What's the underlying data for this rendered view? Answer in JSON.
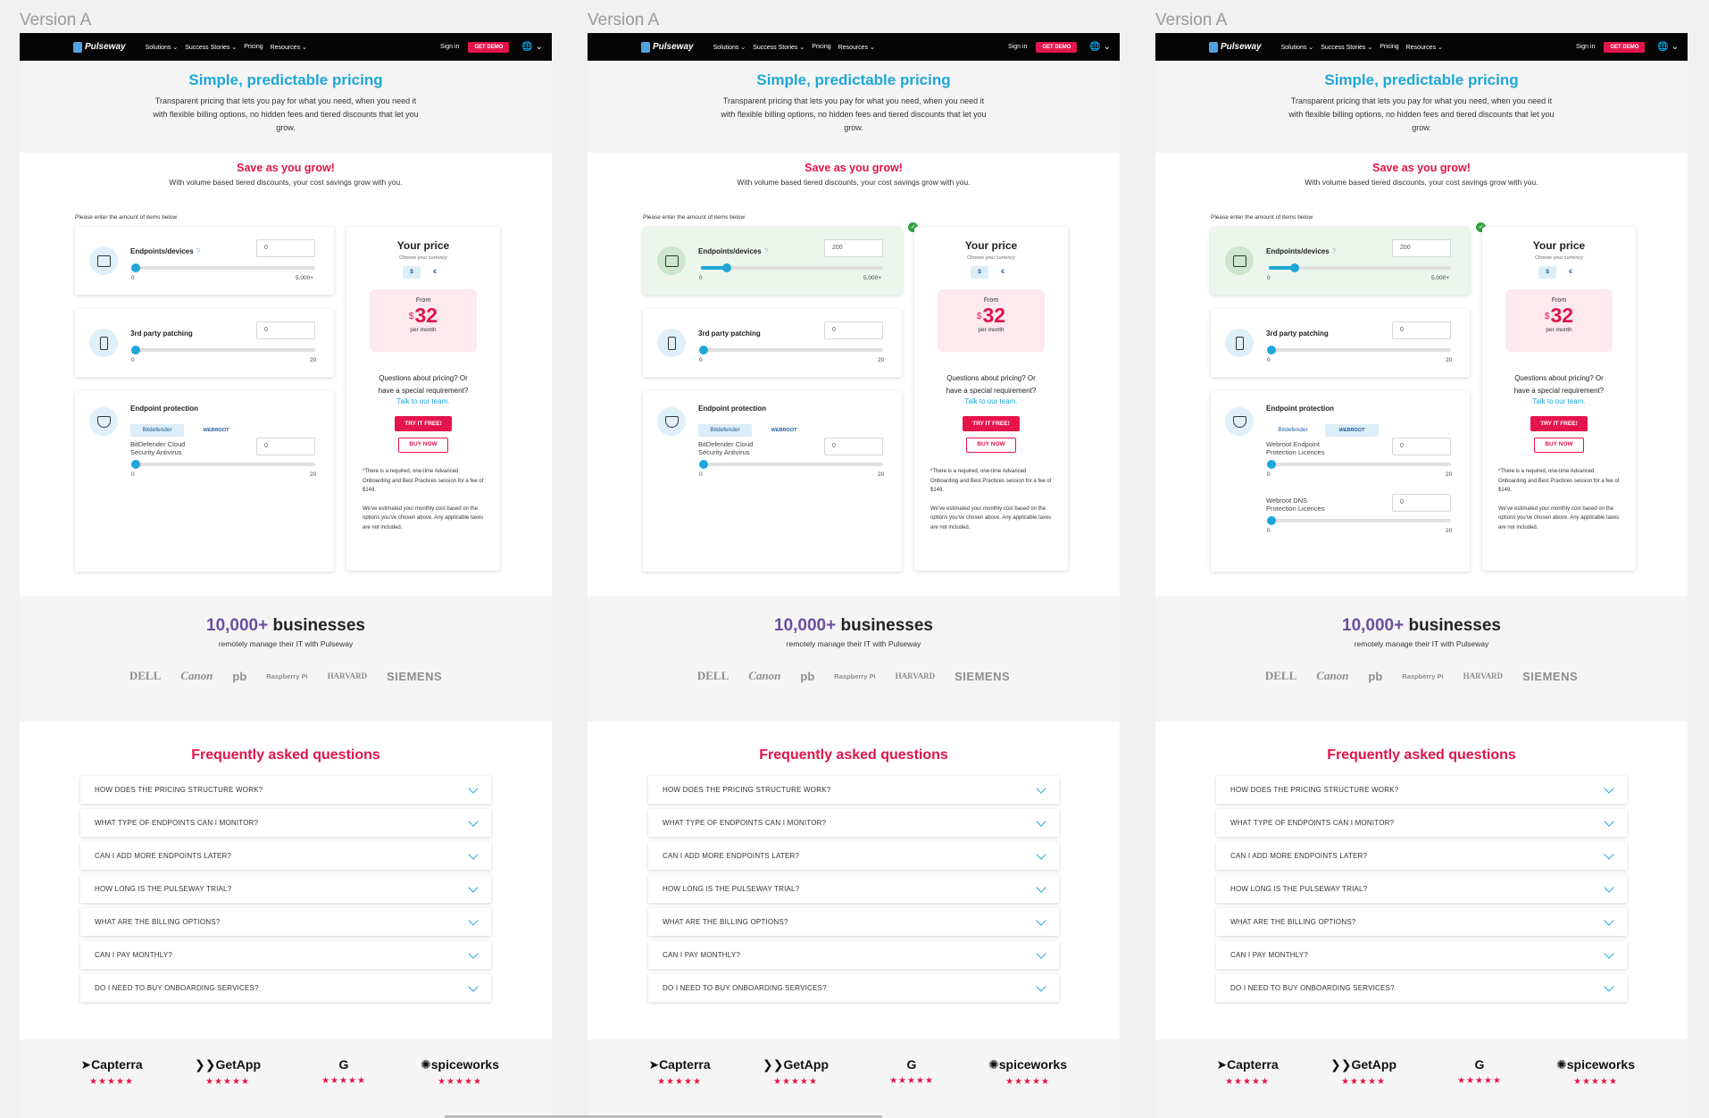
{
  "versions": [
    {
      "label": "Version A",
      "endpoints": {
        "value": "0",
        "state": "default"
      },
      "protection_selected": "bitdefender",
      "protection_rows": [
        {
          "label_line1": "BitDefender Cloud",
          "label_line2": "Security Antivirus",
          "value": "0",
          "max": "20"
        }
      ]
    },
    {
      "label": "Version A",
      "endpoints": {
        "value": "200",
        "state": "active"
      },
      "protection_selected": "bitdefender",
      "protection_rows": [
        {
          "label_line1": "BitDefender Cloud",
          "label_line2": "Security Antivirus",
          "value": "0",
          "max": "20"
        }
      ]
    },
    {
      "label": "Version A",
      "endpoints": {
        "value": "200",
        "state": "active"
      },
      "protection_selected": "webroot",
      "protection_rows": [
        {
          "label_line1": "Webroot Endpoint",
          "label_line2": "Protection Licences",
          "value": "0",
          "max": "20"
        },
        {
          "label_line1": "Webroot DNS",
          "label_line2": "Protection Licences",
          "value": "0",
          "max": "20"
        }
      ]
    }
  ],
  "nav": {
    "logo": "Pulseway",
    "links": [
      "Solutions ⌄",
      "Success Stories ⌄",
      "Pricing",
      "Resources ⌄"
    ],
    "signin": "Sign in",
    "demo": "GET DEMO",
    "globe": "🌐 ⌄"
  },
  "hero": {
    "title": "Simple, predictable pricing",
    "text": "Transparent pricing that lets you pay for what you need, when you need it with flexible billing options, no hidden fees and tiered discounts that let you grow."
  },
  "save": {
    "title": "Save as you grow!",
    "subtitle": "With volume based tiered discounts, your cost savings grow with you.",
    "instruction": "Please enter the amount of items below"
  },
  "endpoints_card": {
    "title": "Endpoints/devices",
    "help": "?",
    "min": "0",
    "max": "5,000+"
  },
  "patching_card": {
    "title": "3rd party patching",
    "value": "0",
    "min": "0",
    "max": "20"
  },
  "protection_card": {
    "title": "Endpoint protection",
    "vendor1": "Bitdefender",
    "vendor2": "WEBROOT",
    "min": "0"
  },
  "price": {
    "title": "Your price",
    "currency_hint": "Choose your currency",
    "currencies": [
      "$",
      "€"
    ],
    "from": "From",
    "symbol": "$",
    "amount": "32",
    "per": "per month",
    "question": "Questions about pricing? Or have a special requirement?",
    "link": "Talk to our team.",
    "try": "TRY IT FREE!",
    "buy": "BUY NOW",
    "fine1": "*There is a required, one-time Advanced Onboarding and Best Practices session for a fee of $149.",
    "fine2": "We've estimated your monthly cost based on the options you've chosen above. Any applicable taxes are not included."
  },
  "businesses": {
    "count": "10,000+",
    "word": " businesses",
    "sub": "remotely manage their IT with Pulseway",
    "logos": [
      "DELL",
      "Canon",
      "pb",
      "Raspberry Pi",
      "HARVARD",
      "SIEMENS"
    ]
  },
  "faq": {
    "title": "Frequently asked questions",
    "items": [
      "HOW DOES THE PRICING STRUCTURE WORK?",
      "WHAT TYPE OF ENDPOINTS CAN I MONITOR?",
      "CAN I ADD MORE ENDPOINTS LATER?",
      "HOW LONG IS THE PULSEWAY TRIAL?",
      "WHAT ARE THE BILLING OPTIONS?",
      "CAN I PAY MONTHLY?",
      "DO I NEED TO BUY ONBOARDING SERVICES?"
    ]
  },
  "reviews": {
    "items": [
      {
        "name": "Capterra",
        "glyph": "➤",
        "stars": "★★★★★"
      },
      {
        "name": "GetApp",
        "glyph": "❯❯",
        "stars": "★★★★★"
      },
      {
        "name": "",
        "glyph": "G",
        "stars": "★★★★★"
      },
      {
        "name": "spiceworks",
        "glyph": "✺",
        "stars": "★★★★★"
      }
    ]
  },
  "colors": {
    "accent_blue": "#1ea7d8",
    "brand_red": "#e5154b",
    "active_green": "#ecf6ec",
    "check_green": "#2fa33f"
  }
}
